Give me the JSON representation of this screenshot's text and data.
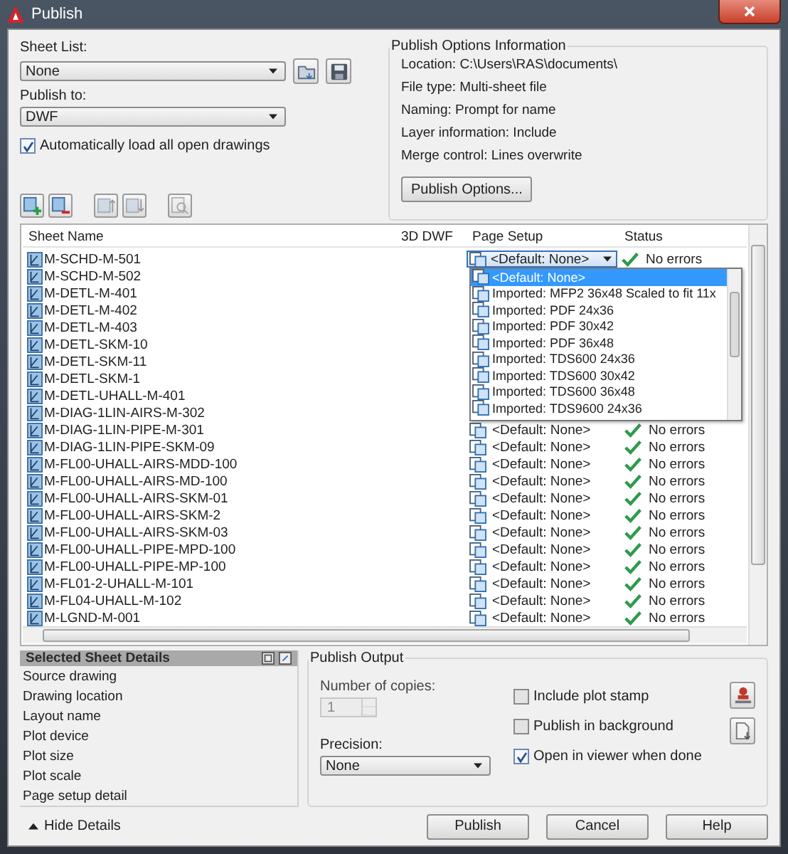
{
  "window": {
    "title": "Publish"
  },
  "sheet_list": {
    "label": "Sheet List:",
    "value": "None"
  },
  "publish_to": {
    "label": "Publish to:",
    "value": "DWF"
  },
  "auto_load": {
    "label": "Automatically load all open drawings",
    "checked": true
  },
  "options_info": {
    "title": "Publish Options Information",
    "lines": [
      "Location: C:\\Users\\RAS\\documents\\",
      "File type: Multi-sheet file",
      "Naming: Prompt for name",
      "Layer information: Include",
      "Merge control: Lines overwrite"
    ],
    "button": "Publish Options..."
  },
  "table": {
    "columns": [
      "Sheet Name",
      "3D DWF",
      "Page Setup",
      "Status"
    ],
    "rows": [
      {
        "name": "M-SCHD-M-501",
        "kind": "combo",
        "page_setup": "<Default: None>",
        "status": "No errors"
      },
      {
        "name": "M-SCHD-M-502",
        "kind": "covered"
      },
      {
        "name": "M-DETL-M-401",
        "kind": "covered"
      },
      {
        "name": "M-DETL-M-402",
        "kind": "covered"
      },
      {
        "name": "M-DETL-M-403",
        "kind": "covered"
      },
      {
        "name": "M-DETL-SKM-10",
        "kind": "covered"
      },
      {
        "name": "M-DETL-SKM-11",
        "kind": "covered"
      },
      {
        "name": "M-DETL-SKM-1",
        "kind": "covered"
      },
      {
        "name": "M-DETL-UHALL-M-401",
        "kind": "covered"
      },
      {
        "name": "M-DIAG-1LIN-AIRS-M-302",
        "kind": "covered"
      },
      {
        "name": "M-DIAG-1LIN-PIPE-M-301",
        "kind": "plain",
        "page_setup": "<Default: None>",
        "status": "No errors"
      },
      {
        "name": "M-DIAG-1LIN-PIPE-SKM-09",
        "kind": "plain",
        "page_setup": "<Default: None>",
        "status": "No errors"
      },
      {
        "name": "M-FL00-UHALL-AIRS-MDD-100",
        "kind": "plain",
        "page_setup": "<Default: None>",
        "status": "No errors"
      },
      {
        "name": "M-FL00-UHALL-AIRS-MD-100",
        "kind": "plain",
        "page_setup": "<Default: None>",
        "status": "No errors"
      },
      {
        "name": "M-FL00-UHALL-AIRS-SKM-01",
        "kind": "plain",
        "page_setup": "<Default: None>",
        "status": "No errors"
      },
      {
        "name": "M-FL00-UHALL-AIRS-SKM-2",
        "kind": "plain",
        "page_setup": "<Default: None>",
        "status": "No errors"
      },
      {
        "name": "M-FL00-UHALL-AIRS-SKM-03",
        "kind": "plain",
        "page_setup": "<Default: None>",
        "status": "No errors"
      },
      {
        "name": "M-FL00-UHALL-PIPE-MPD-100",
        "kind": "plain",
        "page_setup": "<Default: None>",
        "status": "No errors"
      },
      {
        "name": "M-FL00-UHALL-PIPE-MP-100",
        "kind": "plain",
        "page_setup": "<Default: None>",
        "status": "No errors"
      },
      {
        "name": "M-FL01-2-UHALL-M-101",
        "kind": "plain",
        "page_setup": "<Default: None>",
        "status": "No errors"
      },
      {
        "name": "M-FL04-UHALL-M-102",
        "kind": "plain",
        "page_setup": "<Default: None>",
        "status": "No errors"
      },
      {
        "name": "M-LGND-M-001",
        "kind": "plain",
        "page_setup": "<Default: None>",
        "status": "No errors"
      }
    ]
  },
  "page_setup_dropdown": {
    "options": [
      {
        "label": "<Default: None>",
        "selected": true
      },
      {
        "label": "Imported: MFP2 36x48 Scaled to fit 11x",
        "selected": false
      },
      {
        "label": "Imported: PDF 24x36",
        "selected": false
      },
      {
        "label": "Imported: PDF 30x42",
        "selected": false
      },
      {
        "label": "Imported: PDF 36x48",
        "selected": false
      },
      {
        "label": "Imported: TDS600 24x36",
        "selected": false
      },
      {
        "label": "Imported: TDS600 30x42",
        "selected": false
      },
      {
        "label": "Imported: TDS600 36x48",
        "selected": false
      },
      {
        "label": "Imported: TDS9600 24x36",
        "selected": false
      }
    ]
  },
  "details": {
    "title": "Selected Sheet Details",
    "items": [
      "Source drawing",
      "Drawing location",
      "Layout name",
      "Plot device",
      "Plot size",
      "Plot scale",
      "Page setup detail"
    ],
    "toggle": "Hide Details"
  },
  "publish_output": {
    "title": "Publish Output",
    "copies": {
      "label": "Number of copies:",
      "value": "1",
      "disabled": true
    },
    "precision": {
      "label": "Precision:",
      "value": "None"
    },
    "options": [
      {
        "label": "Include plot stamp",
        "checked": false
      },
      {
        "label": "Publish in background",
        "checked": false
      },
      {
        "label": "Open in viewer when done",
        "checked": true
      }
    ]
  },
  "buttons": [
    "Publish",
    "Cancel",
    "Help"
  ]
}
